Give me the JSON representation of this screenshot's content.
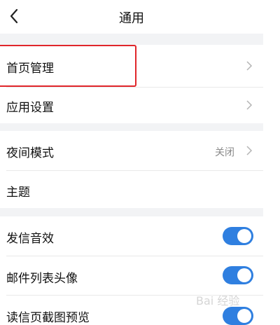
{
  "header": {
    "title": "通用"
  },
  "rows": [
    {
      "label": "首页管理",
      "chevron": true
    },
    {
      "label": "应用设置",
      "chevron": true
    },
    {
      "label": "夜间模式",
      "value": "关闭",
      "chevron": true
    },
    {
      "label": "主题"
    },
    {
      "label": "发信音效",
      "toggle": "on"
    },
    {
      "label": "邮件列表头像",
      "toggle": "on"
    },
    {
      "label": "读信页截图预览",
      "toggle": "on"
    }
  ],
  "colors": {
    "toggle_on": "#2f7fe0",
    "highlight": "#e0262b",
    "section_gap": "#f2f3f5"
  },
  "icons": {
    "back": "chevron-left-icon",
    "row_arrow": "chevron-right-icon"
  },
  "watermark": "Bai 经验"
}
